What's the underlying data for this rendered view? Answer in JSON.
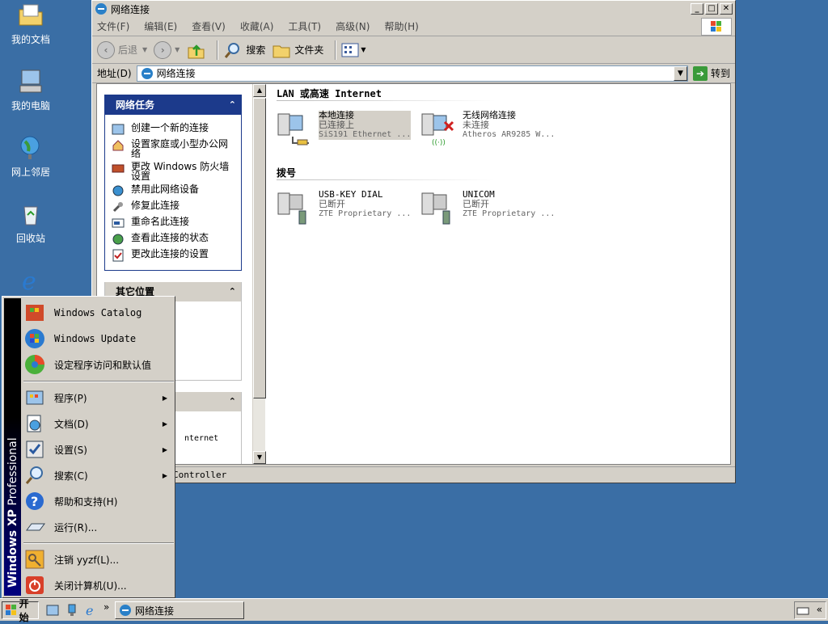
{
  "desktop": {
    "icons": [
      {
        "label": "我的文档"
      },
      {
        "label": "我的电脑"
      },
      {
        "label": "网上邻居"
      },
      {
        "label": "回收站"
      }
    ]
  },
  "window": {
    "title": "网络连接",
    "menu": [
      "文件(F)",
      "编辑(E)",
      "查看(V)",
      "收藏(A)",
      "工具(T)",
      "高级(N)",
      "帮助(H)"
    ],
    "toolbar": {
      "back": "后退",
      "search": "搜索",
      "folders": "文件夹"
    },
    "address_label": "地址(D)",
    "address_value": "网络连接",
    "go_label": "转到",
    "tasks_header": "网络任务",
    "tasks": [
      "创建一个新的连接",
      "设置家庭或小型办公网络",
      "更改 Windows 防火墙设置",
      "禁用此网络设备",
      "修复此连接",
      "重命名此连接",
      "查看此连接的状态",
      "更改此连接的设置"
    ],
    "other_places_header": "其它位置",
    "details_partial": "nternet",
    "lan_header": "LAN 或高速 Internet",
    "dial_header": "拨号",
    "connections": [
      {
        "name": "本地连接",
        "status": "已连接上",
        "device": "SiS191 Ethernet ..."
      },
      {
        "name": "无线网络连接",
        "status": "未连接",
        "device": "Atheros AR9285 W..."
      },
      {
        "name": "USB-KEY DIAL",
        "status": "已断开",
        "device": "ZTE Proprietary ..."
      },
      {
        "name": "UNICOM",
        "status": "已断开",
        "device": "ZTE Proprietary ..."
      }
    ],
    "status_text": "Controller"
  },
  "start_menu": {
    "brand_bold": "Windows XP",
    "brand_light": " Professional",
    "top_items": [
      "Windows Catalog",
      "Windows Update",
      "设定程序访问和默认值"
    ],
    "items": [
      {
        "label": "程序(P)",
        "submenu": true
      },
      {
        "label": "文档(D)",
        "submenu": true
      },
      {
        "label": "设置(S)",
        "submenu": true
      },
      {
        "label": "搜索(C)",
        "submenu": true
      },
      {
        "label": "帮助和支持(H)",
        "submenu": false
      },
      {
        "label": "运行(R)...",
        "submenu": false
      }
    ],
    "bottom_items": [
      "注销 yyzf(L)...",
      "关闭计算机(U)..."
    ]
  },
  "taskbar": {
    "start_label": "开始",
    "quicklaunch_more": "»",
    "task_label": "网络连接",
    "tray_chevron": "«"
  }
}
